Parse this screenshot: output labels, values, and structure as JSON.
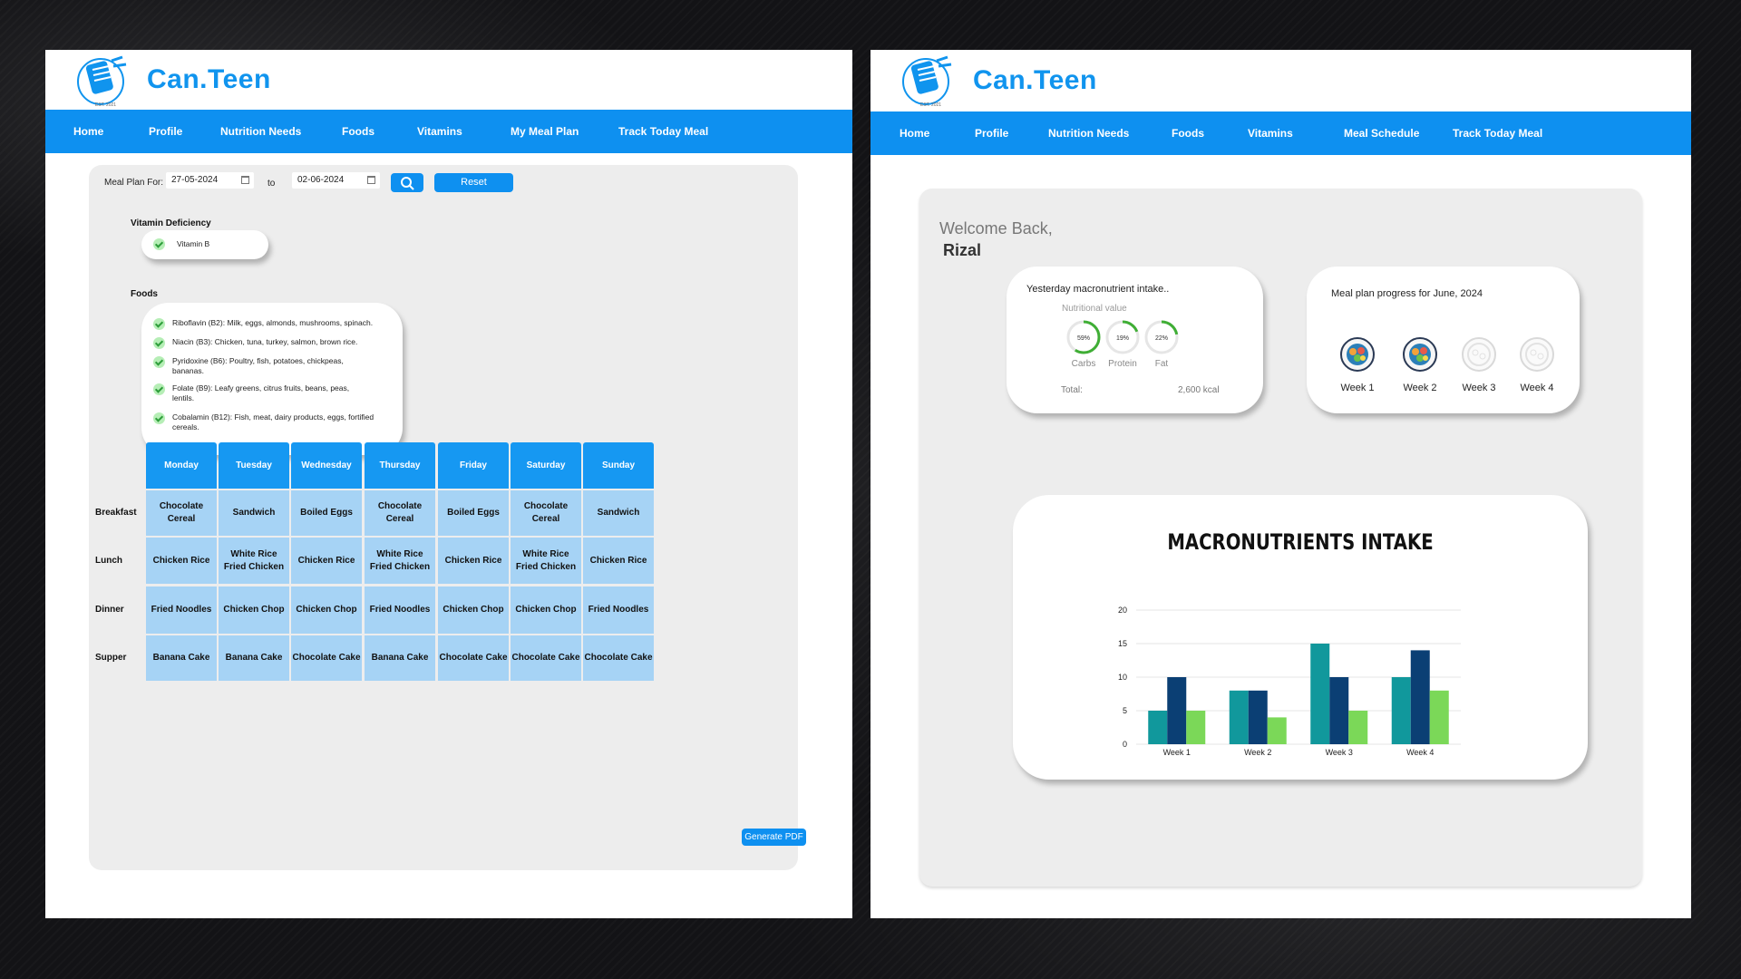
{
  "brand": "Can.Teen",
  "logo_caption": "EST. 2021",
  "left": {
    "nav": [
      "Home",
      "Profile",
      "Nutrition Needs",
      "Foods",
      "Vitamins",
      "My Meal Plan",
      "Track Today Meal"
    ],
    "meal_plan_for": "Meal Plan For:",
    "date_from": "27-05-2024",
    "to": "to",
    "date_to": "02-06-2024",
    "reset": "Reset",
    "vitamin_deficiency_title": "Vitamin Deficiency",
    "vitamin": "Vitamin B",
    "foods_title": "Foods",
    "foods": [
      "Riboflavin (B2): Milk, eggs, almonds, mushrooms, spinach.",
      "Niacin (B3): Chicken, tuna, turkey, salmon, brown rice.",
      "Pyridoxine (B6): Poultry, fish, potatoes, chickpeas, bananas.",
      "Folate (B9): Leafy greens, citrus fruits, beans, peas, lentils.",
      "Cobalamin (B12): Fish, meat, dairy products, eggs, fortified cereals."
    ],
    "days": [
      "Monday",
      "Tuesday",
      "Wednesday",
      "Thursday",
      "Friday",
      "Saturday",
      "Sunday"
    ],
    "meals": [
      "Breakfast",
      "Lunch",
      "Dinner",
      "Supper"
    ],
    "plan": [
      [
        "Chocolate Cereal",
        "Sandwich",
        "Boiled Eggs",
        "Chocolate Cereal",
        "Boiled Eggs",
        "Chocolate Cereal",
        "Sandwich"
      ],
      [
        "Chicken Rice",
        "White Rice\nFried Chicken",
        "Chicken Rice",
        "White Rice\nFried Chicken",
        "Chicken Rice",
        "White Rice\nFried Chicken",
        "Chicken Rice"
      ],
      [
        "Fried Noodles",
        "Chicken Chop",
        "Chicken Chop",
        "Fried Noodles",
        "Chicken Chop",
        "Chicken Chop",
        "Fried Noodles"
      ],
      [
        "Banana Cake",
        "Banana Cake",
        "Chocolate Cake",
        "Banana Cake",
        "Chocolate Cake",
        "Chocolate Cake",
        "Chocolate Cake"
      ]
    ],
    "generate_pdf": "Generate PDF"
  },
  "right": {
    "nav": [
      "Home",
      "Profile",
      "Nutrition Needs",
      "Foods",
      "Vitamins",
      "Meal Schedule",
      "Track Today Meal"
    ],
    "welcome": "Welcome Back,",
    "user": "Rizal",
    "macro_card": {
      "title": "Yesterday macronutrient intake..",
      "subtitle": "Nutritional value",
      "items": [
        {
          "label": "Carbs",
          "pct": "59%",
          "value": 0.59
        },
        {
          "label": "Protein",
          "pct": "19%",
          "value": 0.19
        },
        {
          "label": "Fat",
          "pct": "22%",
          "value": 0.22
        }
      ],
      "total_label": "Total:",
      "total_value": "2,600 kcal",
      "ring_color": "#3fae35"
    },
    "progress_card": {
      "title": "Meal plan progress for June, 2024",
      "weeks": [
        {
          "label": "Week 1",
          "done": true
        },
        {
          "label": "Week 2",
          "done": true
        },
        {
          "label": "Week 3",
          "done": false
        },
        {
          "label": "Week 4",
          "done": false
        }
      ]
    },
    "chart_data": {
      "type": "bar",
      "title": "MACRONUTRIENTS INTAKE",
      "categories": [
        "Week 1",
        "Week 2",
        "Week 3",
        "Week 4"
      ],
      "series": [
        {
          "values": [
            5,
            8,
            15,
            10
          ],
          "color": "#11989c"
        },
        {
          "values": [
            10,
            8,
            10,
            14
          ],
          "color": "#0b3f74"
        },
        {
          "values": [
            5,
            4,
            5,
            8
          ],
          "color": "#7bd858"
        }
      ],
      "yticks": [
        0,
        5,
        10,
        15,
        20
      ],
      "ylim": [
        0,
        20
      ],
      "grid": true
    }
  }
}
